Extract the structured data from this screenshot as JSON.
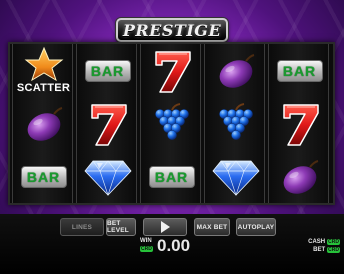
{
  "game": {
    "title": "PRESTIGE",
    "colors": {
      "background": "#8a2cc2",
      "bar_text": "#1a9a2f",
      "seven": "#e01818",
      "plum": "#8d3ab5",
      "grapes": "#1d6fe8",
      "diamond": "#2a6cf0",
      "scatter_star": "#f08a1a",
      "credit_tag": "#27c23a"
    }
  },
  "reels": [
    [
      "scatter",
      "plum",
      "bar"
    ],
    [
      "bar",
      "seven",
      "diamond"
    ],
    [
      "seven",
      "grapes",
      "bar"
    ],
    [
      "plum",
      "grapes",
      "diamond"
    ],
    [
      "bar",
      "seven",
      "plum"
    ]
  ],
  "symbols": {
    "bar_label": "BAR",
    "scatter_label": "SCATTER"
  },
  "controls": {
    "lines_label": "LINES",
    "bet_level_label": "BET LEVEL",
    "spin_icon": "play-icon",
    "max_bet_label": "MAX BET",
    "autoplay_label": "AUTOPLAY"
  },
  "info": {
    "win_label": "WIN",
    "win_currency": "CRD",
    "win_value": "0.00",
    "cash_label": "CASH",
    "cash_currency": "CRD",
    "bet_label": "BET",
    "bet_currency": "CRD"
  }
}
